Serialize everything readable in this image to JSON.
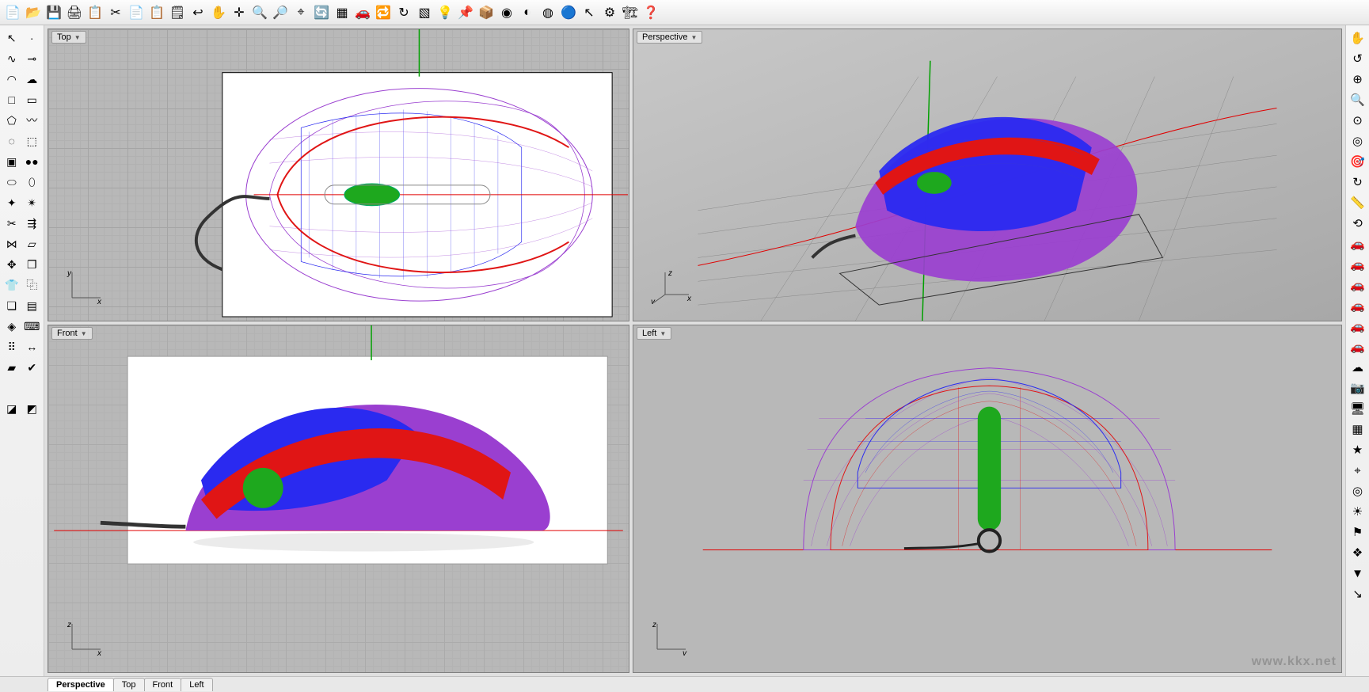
{
  "top_toolbar_icons": [
    "new-file",
    "open-file",
    "save-file",
    "print",
    "clipboard-doc",
    "cut",
    "copy",
    "paste",
    "sticky-note",
    "undo",
    "pan-hand",
    "crosshair",
    "zoom-in",
    "zoom-select",
    "zoom-extents",
    "rotate-view",
    "layers-grid",
    "car-red",
    "car-refresh",
    "orbit-arrow",
    "toggle-layer",
    "lightbulb",
    "pushpin",
    "box-red",
    "circle-rainbow",
    "sphere-half",
    "sphere-wire",
    "sphere-blue",
    "cursor-yellow",
    "gear-yellow",
    "hierarchy",
    "help"
  ],
  "top_toolbar_glyphs": [
    "📄",
    "📂",
    "💾",
    "🖨",
    "📋",
    "✂",
    "📄",
    "📋",
    "🗒",
    "↩",
    "✋",
    "✛",
    "🔍",
    "🔎",
    "⌖",
    "🔄",
    "▦",
    "🚗",
    "🔁",
    "↻",
    "▧",
    "💡",
    "📌",
    "📦",
    "◉",
    "◐",
    "◍",
    "🔵",
    "↖",
    "⚙",
    "🏗",
    "❓"
  ],
  "left_toolbar": [
    {
      "name": "select-arrow",
      "g": "↖"
    },
    {
      "name": "point",
      "g": "·"
    },
    {
      "name": "curve",
      "g": "∿"
    },
    {
      "name": "snap-end",
      "g": "⊸"
    },
    {
      "name": "arc",
      "g": "◠"
    },
    {
      "name": "cloud",
      "g": "☁"
    },
    {
      "name": "square",
      "g": "□"
    },
    {
      "name": "rect",
      "g": "▭"
    },
    {
      "name": "polygon",
      "g": "⬠"
    },
    {
      "name": "freeform",
      "g": "〰"
    },
    {
      "name": "lasso-select",
      "g": "◌"
    },
    {
      "name": "paint-select",
      "g": "⬚"
    },
    {
      "name": "box-blue",
      "g": "▣"
    },
    {
      "name": "spheres",
      "g": "●●"
    },
    {
      "name": "cylinder",
      "g": "⬭"
    },
    {
      "name": "pipe",
      "g": "⬯"
    },
    {
      "name": "mesh-tool",
      "g": "✦"
    },
    {
      "name": "explode",
      "g": "✴"
    },
    {
      "name": "trim",
      "g": "✂"
    },
    {
      "name": "offset",
      "g": "⇶"
    },
    {
      "name": "join",
      "g": "⋈"
    },
    {
      "name": "cplane",
      "g": "▱"
    },
    {
      "name": "move",
      "g": "✥"
    },
    {
      "name": "copy-geo",
      "g": "❐"
    },
    {
      "name": "shirt",
      "g": "👕"
    },
    {
      "name": "array",
      "g": "⿻"
    },
    {
      "name": "group",
      "g": "❏"
    },
    {
      "name": "align",
      "g": "▤"
    },
    {
      "name": "cube-view",
      "g": "◈"
    },
    {
      "name": "keyboard",
      "g": "⌨"
    },
    {
      "name": "dots-grid",
      "g": "⠿"
    },
    {
      "name": "dim",
      "g": "↔"
    },
    {
      "name": "surface",
      "g": "▰"
    },
    {
      "name": "check",
      "g": "✔"
    },
    {
      "name": "blank1",
      "g": ""
    },
    {
      "name": "blank2",
      "g": ""
    },
    {
      "name": "render-a",
      "g": "◪"
    },
    {
      "name": "render-b",
      "g": "◩"
    }
  ],
  "right_toolbar": [
    {
      "name": "pan-hand",
      "g": "✋"
    },
    {
      "name": "rotate-hand",
      "g": "↺"
    },
    {
      "name": "zoom-dyn",
      "g": "⊕"
    },
    {
      "name": "zoom-win",
      "g": "🔍"
    },
    {
      "name": "zoom-ext",
      "g": "⊙"
    },
    {
      "name": "zoom-sel",
      "g": "◎"
    },
    {
      "name": "mag-target",
      "g": "🎯"
    },
    {
      "name": "redo-view",
      "g": "↻"
    },
    {
      "name": "ruler-scale",
      "g": "📏"
    },
    {
      "name": "reset",
      "g": "⟲"
    },
    {
      "name": "car-red1",
      "g": "🚗"
    },
    {
      "name": "car-red2",
      "g": "🚗"
    },
    {
      "name": "car-red3",
      "g": "🚗"
    },
    {
      "name": "car-red4",
      "g": "🚗"
    },
    {
      "name": "car-red5",
      "g": "🚗"
    },
    {
      "name": "car-red6",
      "g": "🚗"
    },
    {
      "name": "cloud-view",
      "g": "☁"
    },
    {
      "name": "camera",
      "g": "📷"
    },
    {
      "name": "monitor",
      "g": "🖥"
    },
    {
      "name": "windows-4",
      "g": "▦"
    },
    {
      "name": "star",
      "g": "★"
    },
    {
      "name": "zoom-r",
      "g": "⌖"
    },
    {
      "name": "target",
      "g": "◎"
    },
    {
      "name": "sun-target",
      "g": "☀"
    },
    {
      "name": "flag-pin",
      "g": "⚑"
    },
    {
      "name": "mystery",
      "g": "❖"
    },
    {
      "name": "shade",
      "g": "▼"
    },
    {
      "name": "cursor-end",
      "g": "↘"
    }
  ],
  "viewports": {
    "top": {
      "label": "Top",
      "axis1": "y",
      "axis2": "x"
    },
    "persp": {
      "label": "Perspective",
      "axis1": "z",
      "axis2": "x",
      "axis0": "y"
    },
    "front": {
      "label": "Front",
      "axis1": "z",
      "axis2": "x"
    },
    "left": {
      "label": "Left",
      "axis1": "z",
      "axis2": "y"
    }
  },
  "tabs": [
    "Perspective",
    "Top",
    "Front",
    "Left"
  ],
  "active_tab": "Perspective",
  "watermark": "www.kkx.net",
  "colors": {
    "mesh_blue": "#2a2af0",
    "mesh_purple": "#9a3fd0",
    "mesh_red": "#e01515",
    "mesh_green": "#1ea81e",
    "guide_red": "#e00000",
    "axis_green": "#00a000"
  }
}
